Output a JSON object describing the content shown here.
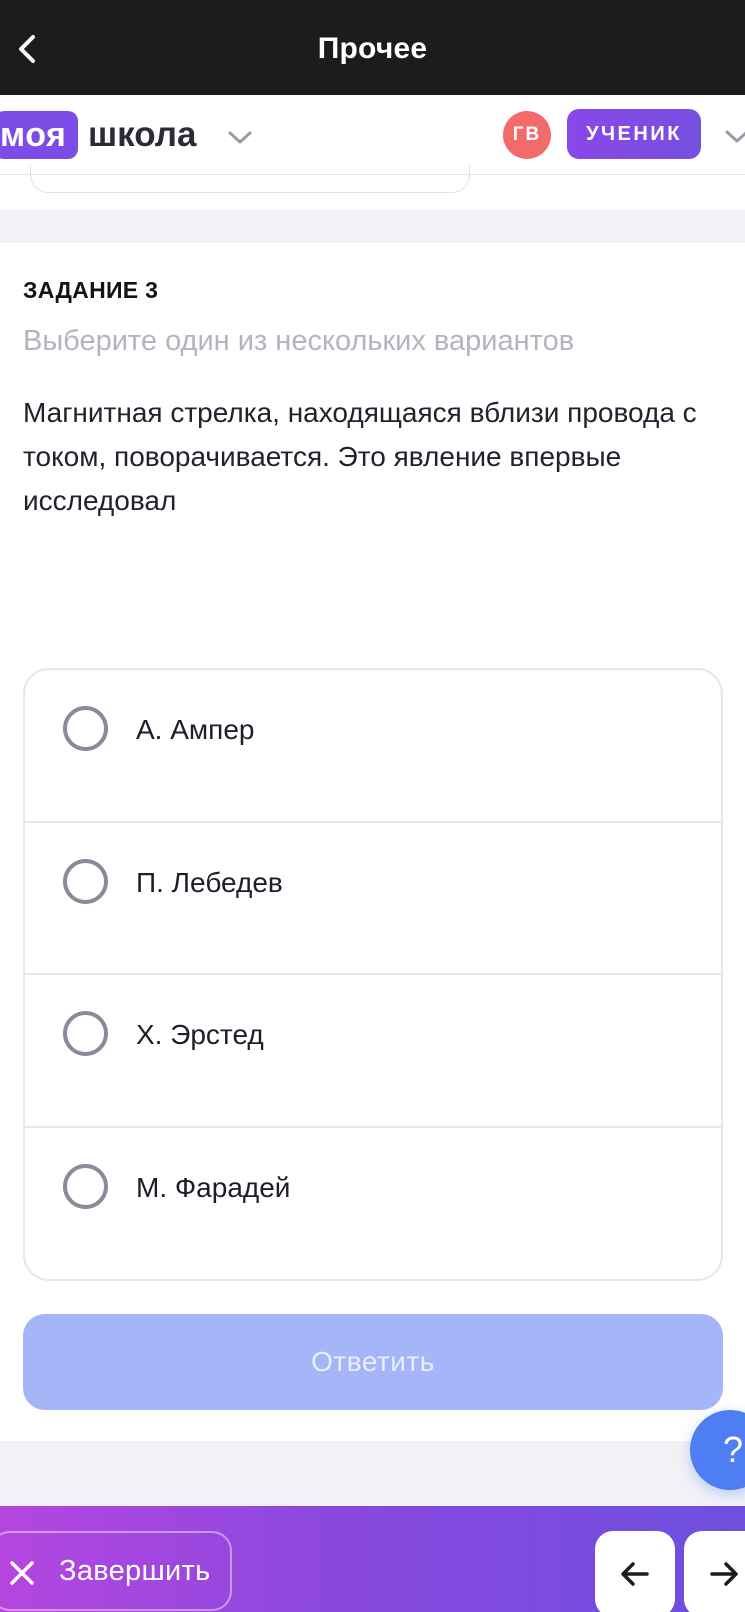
{
  "topbar": {
    "title": "Прочее"
  },
  "school_header": {
    "logo_part1": "моя",
    "logo_part2": "школа",
    "avatar_initials": "ГВ",
    "role": "УЧЕНИК"
  },
  "task": {
    "label": "ЗАДАНИЕ 3",
    "instruction": "Выберите один из нескольких вариантов",
    "question": "Магнитная стрелка, находящаяся вблизи провода с током, поворачивается. Это явление впервые исследовал",
    "options": [
      {
        "label": "А. Ампер"
      },
      {
        "label": "П. Лебедев"
      },
      {
        "label": "Х. Эрстед"
      },
      {
        "label": "М. Фарадей"
      }
    ],
    "submit_label": "Ответить"
  },
  "help": {
    "label": "?"
  },
  "bottombar": {
    "finish_label": "Завершить"
  },
  "colors": {
    "accent_purple": "#7b4de6",
    "avatar_red": "#f36a6a",
    "submit_disabled": "#a5b6f8",
    "help_blue": "#4f7ef3"
  }
}
